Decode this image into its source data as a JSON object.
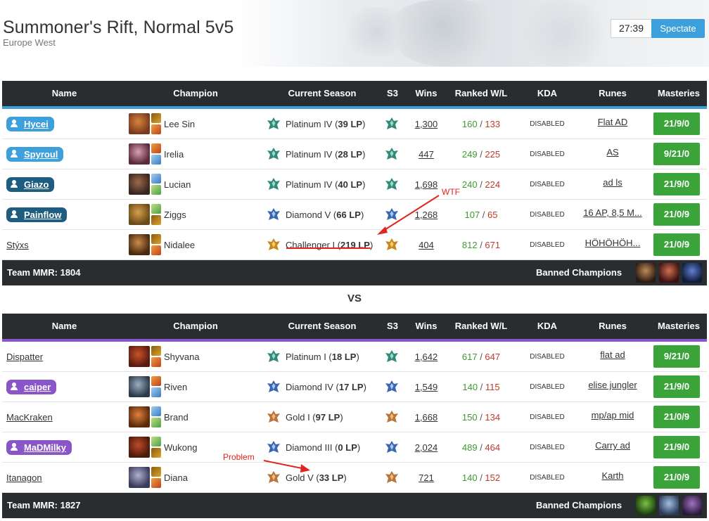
{
  "header": {
    "title": "Summoner's Rift, Normal 5v5",
    "subtitle": "Europe West",
    "timer": "27:39",
    "spectate_label": "Spectate"
  },
  "columns": [
    "Name",
    "Champion",
    "Current Season",
    "S3",
    "Wins",
    "Ranked W/L",
    "KDA",
    "Runes",
    "Masteries"
  ],
  "team1": {
    "accent_color": "#3da0dc",
    "footer_mmr": "Team MMR: 1804",
    "banned_label": "Banned Champions",
    "rows": [
      {
        "name": "Hycei",
        "badge": true,
        "badge_color": "#3da0dc",
        "champion": "Lee Sin",
        "tier": "Platinum IV (",
        "lp": "39 LP",
        "close": ")",
        "tier_type": "platinum",
        "s3_type": "platinum",
        "wins": "1,300",
        "w": "160",
        "l": "133",
        "kda": "DISABLED",
        "runes": "Flat AD",
        "masteries": "21/9/0"
      },
      {
        "name": "Spyroul",
        "badge": true,
        "badge_color": "#3da0dc",
        "champion": "Irelia",
        "tier": "Platinum IV (",
        "lp": "28 LP",
        "close": ")",
        "tier_type": "platinum",
        "s3_type": "platinum",
        "wins": "447",
        "w": "249",
        "l": "225",
        "kda": "DISABLED",
        "runes": "AS",
        "masteries": "9/21/0"
      },
      {
        "name": "Giazo",
        "badge": true,
        "badge_color": "#1e5c80",
        "champion": "Lucian",
        "tier": "Platinum IV (",
        "lp": "40 LP",
        "close": ")",
        "tier_type": "platinum",
        "s3_type": "platinum",
        "wins": "1,698",
        "w": "240",
        "l": "224",
        "kda": "DISABLED",
        "runes": "ad ls",
        "masteries": "21/9/0"
      },
      {
        "name": "Painflow",
        "badge": true,
        "badge_color": "#1e5c80",
        "champion": "Ziggs",
        "tier": "Diamond V (",
        "lp": "66 LP",
        "close": ")",
        "tier_type": "diamond",
        "s3_type": "diamond",
        "wins": "1,268",
        "w": "107",
        "l": "65",
        "kda": "DISABLED",
        "runes": "16 AP, 8,5 M...",
        "masteries": "21/0/9"
      },
      {
        "name": "Stýxs",
        "badge": false,
        "badge_color": "",
        "champion": "Nidalee",
        "tier": "Challenger I (",
        "lp": "219 LP",
        "close": ")",
        "tier_type": "challenger",
        "s3_type": "challenger",
        "wins": "404",
        "w": "812",
        "l": "671",
        "kda": "DISABLED",
        "runes": "HÖHÖHÖH...",
        "masteries": "21/0/9"
      }
    ],
    "bans": [
      "ban-1",
      "ban-2",
      "ban-3"
    ]
  },
  "vs_label": "VS",
  "team2": {
    "accent_color": "#8a55c9",
    "footer_mmr": "Team MMR: 1827",
    "banned_label": "Banned Champions",
    "rows": [
      {
        "name": "Dispatter",
        "badge": false,
        "badge_color": "",
        "champion": "Shyvana",
        "tier": "Platinum I (",
        "lp": "18 LP",
        "close": ")",
        "tier_type": "platinum",
        "s3_type": "platinum",
        "wins": "1,642",
        "w": "617",
        "l": "647",
        "kda": "DISABLED",
        "runes": "flat ad",
        "masteries": "9/21/0"
      },
      {
        "name": "caiper",
        "badge": true,
        "badge_color": "#8a55c9",
        "champion": "Riven",
        "tier": "Diamond IV (",
        "lp": "17 LP",
        "close": ")",
        "tier_type": "diamond",
        "s3_type": "diamond",
        "wins": "1,549",
        "w": "140",
        "l": "115",
        "kda": "DISABLED",
        "runes": "elise jungler",
        "masteries": "21/9/0"
      },
      {
        "name": "MacKraken",
        "badge": false,
        "badge_color": "",
        "champion": "Brand",
        "tier": "Gold I (",
        "lp": "97 LP",
        "close": ")",
        "tier_type": "gold",
        "s3_type": "gold",
        "wins": "1,668",
        "w": "150",
        "l": "134",
        "kda": "DISABLED",
        "runes": "mp/ap mid",
        "masteries": "21/0/9"
      },
      {
        "name": "MaDMilky",
        "badge": true,
        "badge_color": "#8a55c9",
        "champion": "Wukong",
        "tier": "Diamond III (",
        "lp": "0 LP",
        "close": ")",
        "tier_type": "diamond",
        "s3_type": "diamond",
        "wins": "2,024",
        "w": "489",
        "l": "464",
        "kda": "DISABLED",
        "runes": "Carry ad",
        "masteries": "21/9/0"
      },
      {
        "name": "Itanagon",
        "badge": false,
        "badge_color": "",
        "champion": "Diana",
        "tier": "Gold V (",
        "lp": "33 LP",
        "close": ")",
        "tier_type": "gold",
        "s3_type": "gold",
        "wins": "721",
        "w": "140",
        "l": "152",
        "kda": "DISABLED",
        "runes": "Karth",
        "masteries": "21/0/9"
      }
    ],
    "bans": [
      "ban-1",
      "ban-2",
      "ban-3"
    ]
  },
  "annotations": {
    "wtf": "WTF",
    "problem": "Problem"
  },
  "colors": {
    "header_bg": "#2a2d30",
    "masteries_green": "#3aa33a",
    "win_green": "#3c9a2e",
    "loss_red": "#c0392b",
    "annotation_red": "#e0251f"
  }
}
